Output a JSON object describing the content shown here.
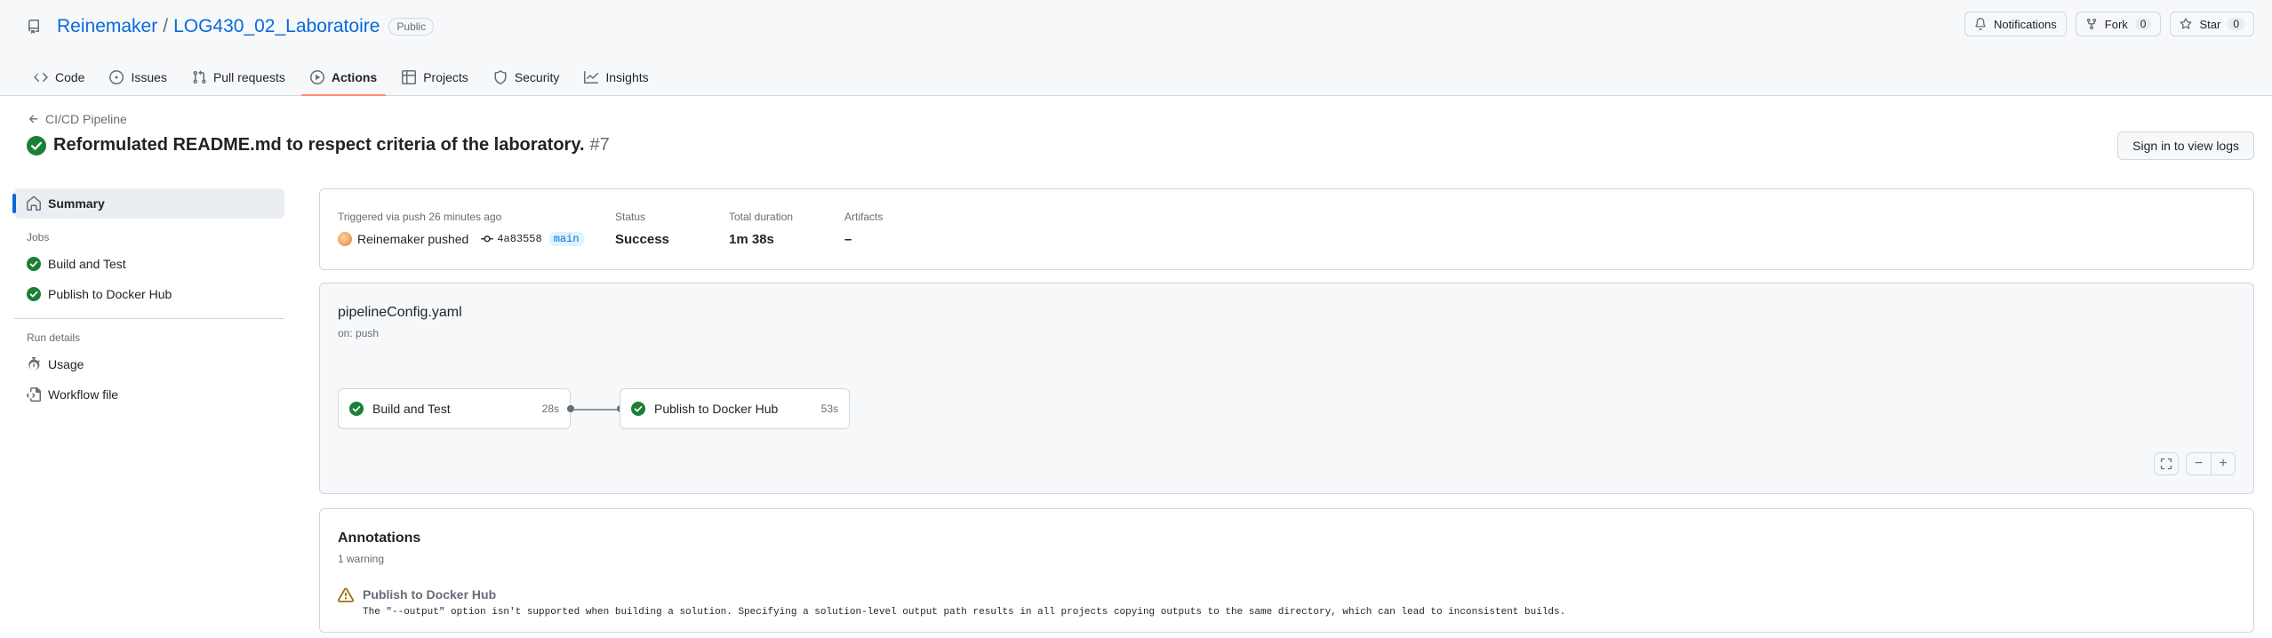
{
  "repo": {
    "owner": "Reinemaker",
    "separator": "/",
    "name": "LOG430_02_Laboratoire",
    "visibility": "Public"
  },
  "repo_actions": {
    "notifications": "Notifications",
    "fork_label": "Fork",
    "fork_count": "0",
    "star_label": "Star",
    "star_count": "0"
  },
  "nav": {
    "tabs": [
      {
        "label": "Code",
        "icon": "code-icon"
      },
      {
        "label": "Issues",
        "icon": "issue-icon"
      },
      {
        "label": "Pull requests",
        "icon": "pull-request-icon"
      },
      {
        "label": "Actions",
        "icon": "play-icon",
        "active": true
      },
      {
        "label": "Projects",
        "icon": "table-icon"
      },
      {
        "label": "Security",
        "icon": "shield-icon"
      },
      {
        "label": "Insights",
        "icon": "graph-icon"
      }
    ]
  },
  "run": {
    "back_label": "CI/CD Pipeline",
    "title": "Reformulated README.md to respect criteria of the laboratory.",
    "number": "#7",
    "signin_label": "Sign in to view logs"
  },
  "sidebar": {
    "summary": "Summary",
    "jobs_heading": "Jobs",
    "jobs": [
      "Build and Test",
      "Publish to Docker Hub"
    ],
    "details_heading": "Run details",
    "usage": "Usage",
    "workflow_file": "Workflow file"
  },
  "summary": {
    "trigger_label": "Triggered via push 26 minutes ago",
    "actor": "Reinemaker pushed",
    "sha": "4a83558",
    "branch": "main",
    "status_label": "Status",
    "status_value": "Success",
    "duration_label": "Total duration",
    "duration_value": "1m 38s",
    "artifacts_label": "Artifacts",
    "artifacts_value": "–"
  },
  "workflow": {
    "file": "pipelineConfig.yaml",
    "trigger": "on: push",
    "jobs": [
      {
        "name": "Build and Test",
        "duration": "28s"
      },
      {
        "name": "Publish to Docker Hub",
        "duration": "53s"
      }
    ],
    "zoom_minus": "−",
    "zoom_plus": "+"
  },
  "annotations": {
    "title": "Annotations",
    "count": "1 warning",
    "items": [
      {
        "job": "Publish to Docker Hub",
        "message": "The \"--output\" option isn't supported when building a solution. Specifying a solution-level output path results in all projects copying outputs to the same directory, which can lead to inconsistent builds."
      }
    ]
  },
  "colors": {
    "success": "#1a7f37",
    "warning": "#9a6700",
    "link": "#0969da",
    "active_tab_underline": "#fd8c73"
  }
}
